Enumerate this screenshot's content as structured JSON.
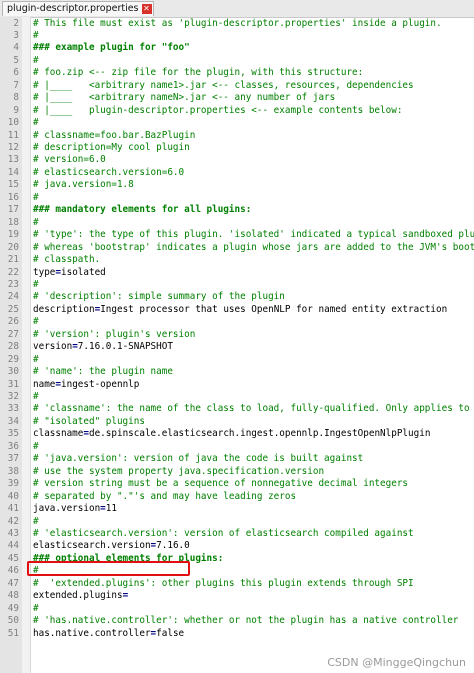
{
  "tab": {
    "filename": "plugin-descriptor.properties"
  },
  "accent_colors": {
    "comment": "#008000",
    "operator": "#000080",
    "highlight_box": "#e01010"
  },
  "lines": [
    {
      "n": "2",
      "text": "# This file must exist as 'plugin-descriptor.properties' inside a plugin.",
      "kind": "comment"
    },
    {
      "n": "3",
      "text": "#",
      "kind": "comment"
    },
    {
      "n": "4",
      "text": "### example plugin for \"foo\"",
      "kind": "section"
    },
    {
      "n": "5",
      "text": "#",
      "kind": "comment"
    },
    {
      "n": "6",
      "text": "# foo.zip <-- zip file for the plugin, with this structure:",
      "kind": "comment"
    },
    {
      "n": "7",
      "text": "# |____   <arbitrary name1>.jar <-- classes, resources, dependencies",
      "kind": "comment"
    },
    {
      "n": "8",
      "text": "# |____   <arbitrary nameN>.jar <-- any number of jars",
      "kind": "comment"
    },
    {
      "n": "9",
      "text": "# |____   plugin-descriptor.properties <-- example contents below:",
      "kind": "comment"
    },
    {
      "n": "10",
      "text": "#",
      "kind": "comment"
    },
    {
      "n": "11",
      "text": "# classname=foo.bar.BazPlugin",
      "kind": "comment"
    },
    {
      "n": "12",
      "text": "# description=My cool plugin",
      "kind": "comment"
    },
    {
      "n": "13",
      "text": "# version=6.0",
      "kind": "comment"
    },
    {
      "n": "14",
      "text": "# elasticsearch.version=6.0",
      "kind": "comment"
    },
    {
      "n": "15",
      "text": "# java.version=1.8",
      "kind": "comment"
    },
    {
      "n": "16",
      "text": "#",
      "kind": "comment"
    },
    {
      "n": "17",
      "text": "### mandatory elements for all plugins:",
      "kind": "section"
    },
    {
      "n": "18",
      "text": "#",
      "kind": "comment"
    },
    {
      "n": "19",
      "text": "# 'type': the type of this plugin. 'isolated' indicated a typical sandboxed plugi",
      "kind": "comment"
    },
    {
      "n": "20",
      "text": "# whereas 'bootstrap' indicates a plugin whose jars are added to the JVM's boot",
      "kind": "comment"
    },
    {
      "n": "21",
      "text": "# classpath.",
      "kind": "comment"
    },
    {
      "n": "22",
      "key": "type",
      "value": "isolated",
      "kind": "prop"
    },
    {
      "n": "23",
      "text": "#",
      "kind": "comment"
    },
    {
      "n": "24",
      "text": "# 'description': simple summary of the plugin",
      "kind": "comment"
    },
    {
      "n": "25",
      "key": "description",
      "value": "Ingest processor that uses OpenNLP for named entity extraction",
      "kind": "prop"
    },
    {
      "n": "26",
      "text": "#",
      "kind": "comment"
    },
    {
      "n": "27",
      "text": "# 'version': plugin's version",
      "kind": "comment"
    },
    {
      "n": "28",
      "key": "version",
      "value": "7.16.0.1-SNAPSHOT",
      "kind": "prop"
    },
    {
      "n": "29",
      "text": "#",
      "kind": "comment"
    },
    {
      "n": "30",
      "text": "# 'name': the plugin name",
      "kind": "comment"
    },
    {
      "n": "31",
      "key": "name",
      "value": "ingest-opennlp",
      "kind": "prop"
    },
    {
      "n": "32",
      "text": "#",
      "kind": "comment"
    },
    {
      "n": "33",
      "text": "# 'classname': the name of the class to load, fully-qualified. Only applies to",
      "kind": "comment"
    },
    {
      "n": "34",
      "text": "# \"isolated\" plugins",
      "kind": "comment"
    },
    {
      "n": "35",
      "key": "classname",
      "value": "de.spinscale.elasticsearch.ingest.opennlp.IngestOpenNlpPlugin",
      "kind": "prop"
    },
    {
      "n": "36",
      "text": "#",
      "kind": "comment"
    },
    {
      "n": "37",
      "text": "# 'java.version': version of java the code is built against",
      "kind": "comment"
    },
    {
      "n": "38",
      "text": "# use the system property java.specification.version",
      "kind": "comment"
    },
    {
      "n": "39",
      "text": "# version string must be a sequence of nonnegative decimal integers",
      "kind": "comment"
    },
    {
      "n": "40",
      "text": "# separated by \".\"'s and may have leading zeros",
      "kind": "comment"
    },
    {
      "n": "41",
      "key": "java.version",
      "value": "11",
      "kind": "prop"
    },
    {
      "n": "42",
      "text": "#",
      "kind": "comment"
    },
    {
      "n": "43",
      "text": "# 'elasticsearch.version': version of elasticsearch compiled against",
      "kind": "comment"
    },
    {
      "n": "44",
      "key": "elasticsearch.version",
      "value": "7.16.0",
      "kind": "prop"
    },
    {
      "n": "45",
      "text": "### optional elements for plugins:",
      "kind": "section"
    },
    {
      "n": "46",
      "text": "#",
      "kind": "comment"
    },
    {
      "n": "47",
      "text": "#  'extended.plugins': other plugins this plugin extends through SPI",
      "kind": "comment"
    },
    {
      "n": "48",
      "key": "extended.plugins",
      "value": "",
      "kind": "prop"
    },
    {
      "n": "49",
      "text": "#",
      "kind": "comment"
    },
    {
      "n": "50",
      "text": "# 'has.native.controller': whether or not the plugin has a native controller",
      "kind": "comment"
    },
    {
      "n": "51",
      "key": "has.native.controller",
      "value": "false",
      "kind": "prop"
    }
  ],
  "watermark": "CSDN @MinggeQingchun"
}
